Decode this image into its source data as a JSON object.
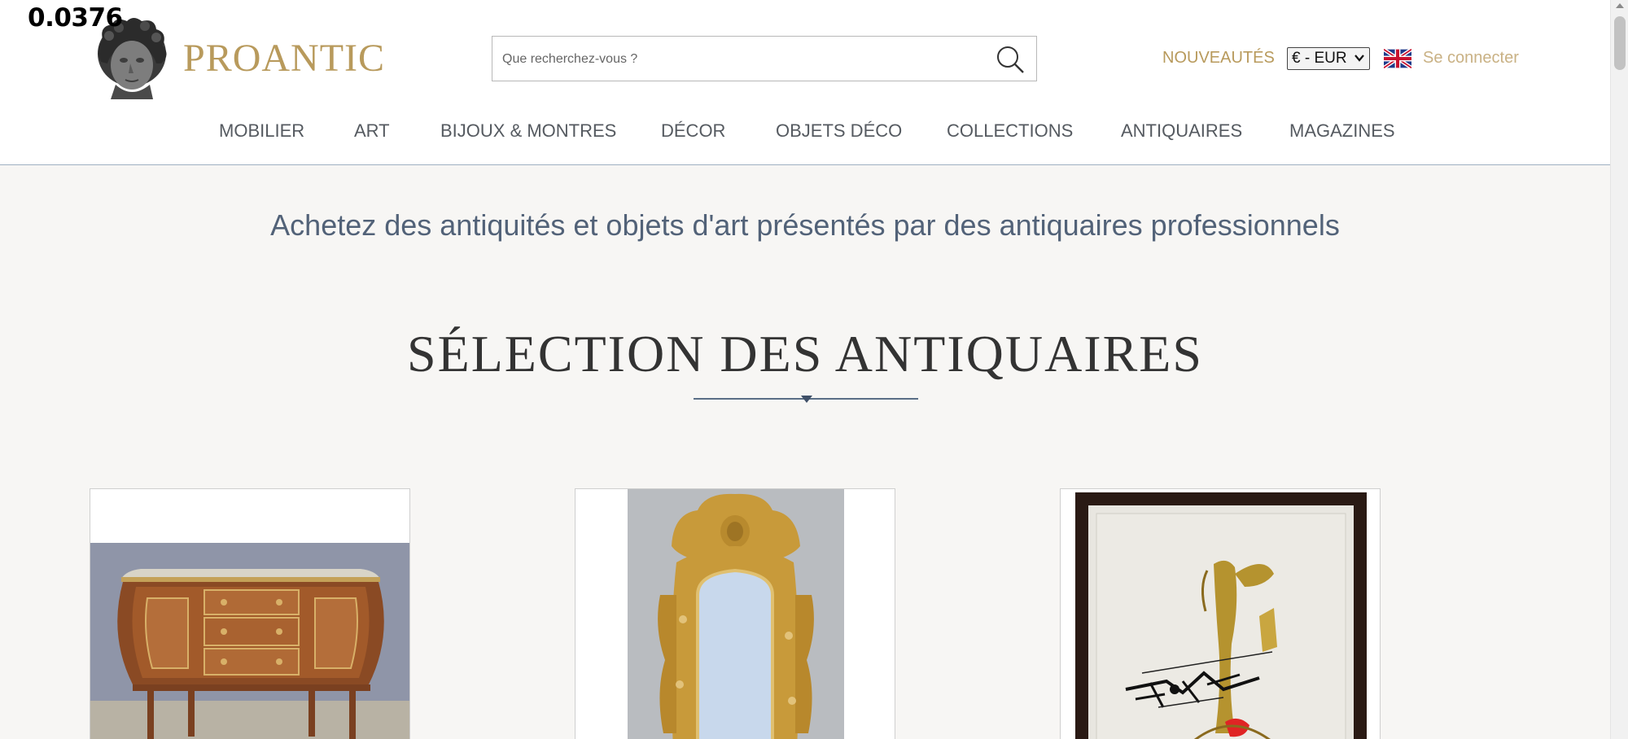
{
  "overlay": {
    "value": "0.0376"
  },
  "header": {
    "logo_text": "PROANTIC",
    "search": {
      "placeholder": "Que recherchez-vous ?",
      "value": ""
    },
    "new_link": "NOUVEAUTÉS",
    "currency": "€ - EUR",
    "language_flag": "uk-flag-icon",
    "login_link": "Se connecter"
  },
  "nav": {
    "items": [
      {
        "label": "MOBILIER"
      },
      {
        "label": "ART"
      },
      {
        "label": "BIJOUX & MONTRES"
      },
      {
        "label": "DÉCOR"
      },
      {
        "label": "OBJETS DÉCO"
      },
      {
        "label": "COLLECTIONS"
      },
      {
        "label": "ANTIQUAIRES"
      },
      {
        "label": "MAGAZINES"
      }
    ]
  },
  "main": {
    "tagline": "Achetez des antiquités et objets d'art présentés par des antiquaires professionnels",
    "section_title": "SÉLECTION DES ANTIQUAIRES",
    "cards": [
      {
        "image": "commode-image"
      },
      {
        "image": "gilded-mirror-image"
      },
      {
        "image": "abstract-painting-image"
      }
    ]
  },
  "colors": {
    "brand_gold": "#b89a5c",
    "tagline_blue": "#526278",
    "nav_text": "#555a60",
    "page_bg": "#f7f6f4"
  }
}
